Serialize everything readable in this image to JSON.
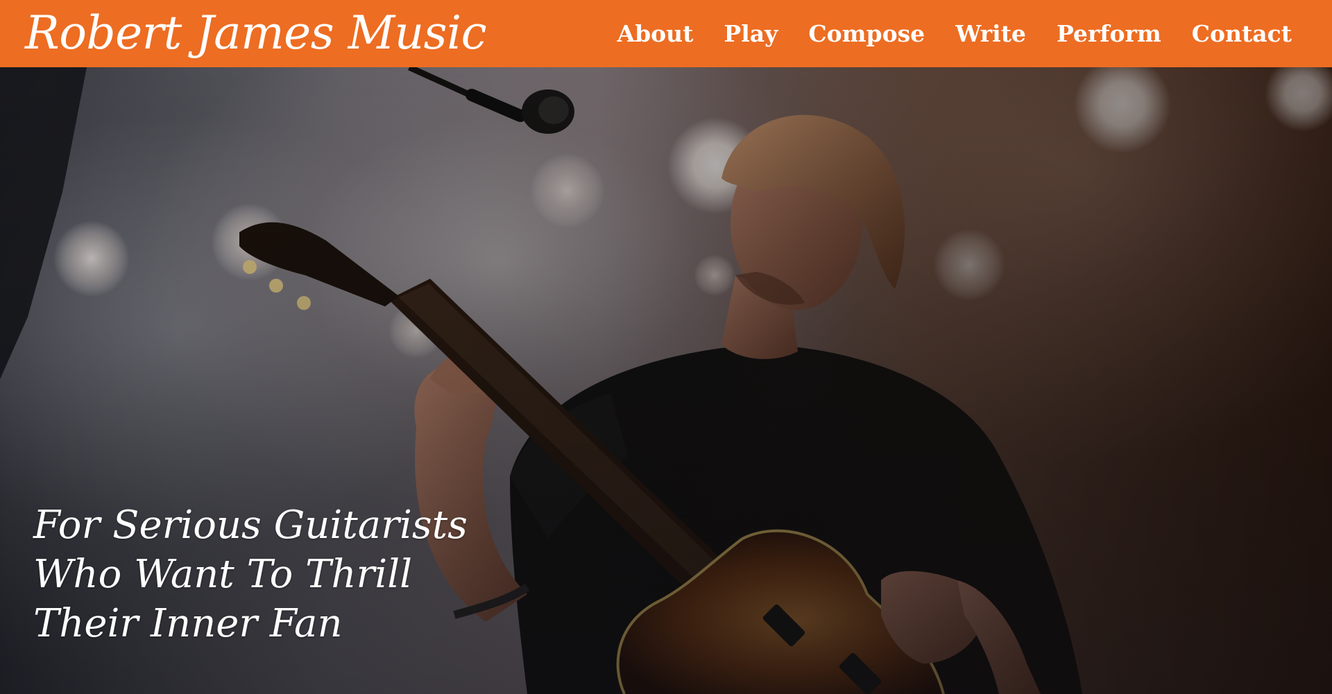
{
  "header": {
    "brand": "Robert James Music",
    "nav": [
      "About",
      "Play",
      "Compose",
      "Write",
      "Perform",
      "Contact"
    ]
  },
  "hero": {
    "headline_lines": [
      "For Serious Guitarists",
      "Who Want To Thrill",
      "Their Inner Fan"
    ],
    "image": "guitarist-on-stage-photo"
  },
  "colors": {
    "header_bg": "#ed6d22",
    "text": "#ffffff"
  },
  "icons": {
    "stage-light": "stage-light-icon",
    "microphone": "microphone-icon",
    "guitar": "guitar-icon"
  }
}
